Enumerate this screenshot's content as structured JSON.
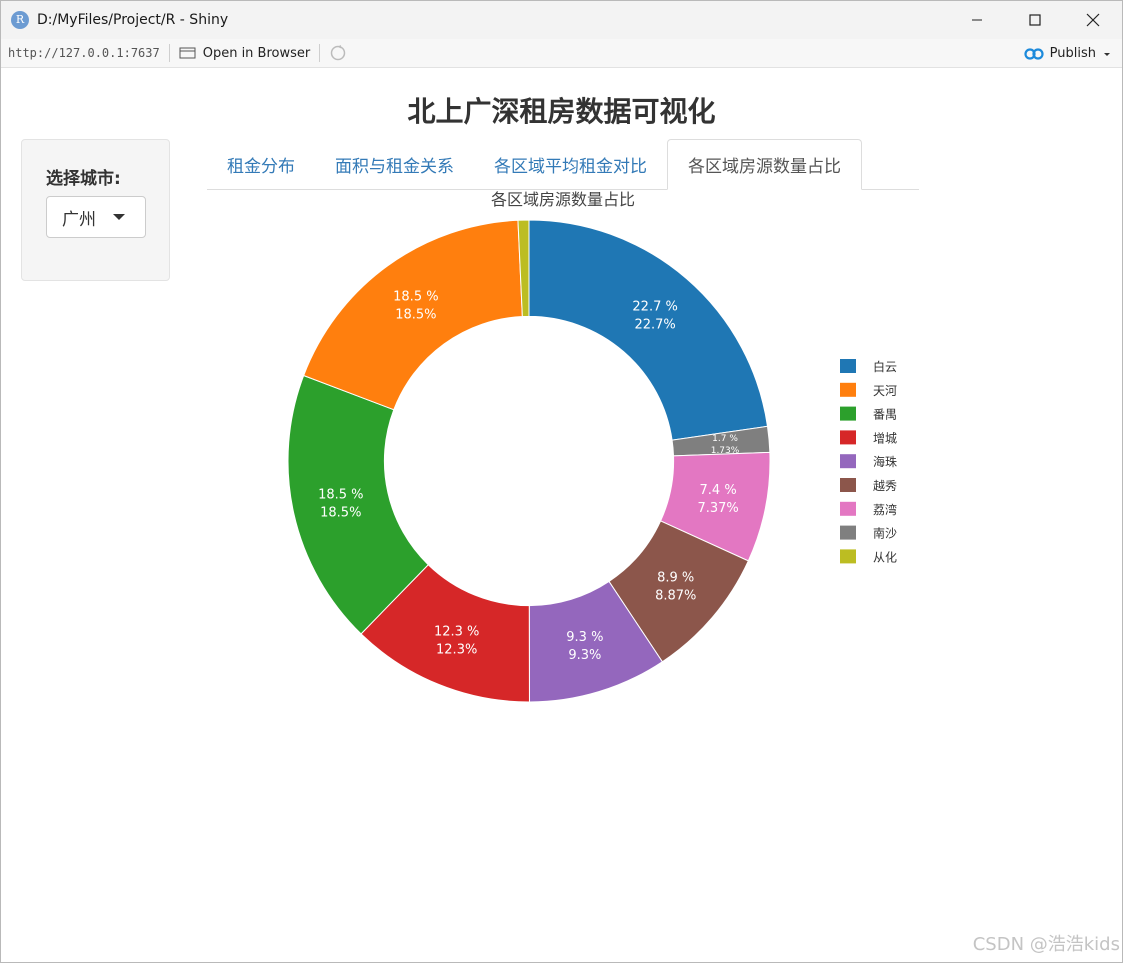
{
  "window": {
    "title": "D:/MyFiles/Project/R - Shiny",
    "app_icon": "R"
  },
  "toolbar": {
    "url": "http://127.0.0.1:7637",
    "open_in_browser": "Open in Browser",
    "publish": "Publish"
  },
  "page": {
    "title": "北上广深租房数据可视化"
  },
  "sidebar": {
    "label": "选择城市:",
    "selected_city": "广州"
  },
  "tabs": [
    {
      "label": "租金分布",
      "active": false
    },
    {
      "label": "面积与租金关系",
      "active": false
    },
    {
      "label": "各区域平均租金对比",
      "active": false
    },
    {
      "label": "各区域房源数量占比",
      "active": true
    }
  ],
  "chart_data": {
    "type": "pie",
    "title": "各区域房源数量占比",
    "hole": 0.6,
    "slices": [
      {
        "name": "白云",
        "value": 22.7,
        "label1": "22.7 %",
        "label2": "22.7%",
        "color": "#1f77b4"
      },
      {
        "name": "南沙",
        "value": 1.73,
        "label1": "1.7 %",
        "label2": "1.73%",
        "color": "#7f7f7f"
      },
      {
        "name": "荔湾",
        "value": 7.37,
        "label1": "7.4 %",
        "label2": "7.37%",
        "color": "#e377c2"
      },
      {
        "name": "越秀",
        "value": 8.87,
        "label1": "8.9 %",
        "label2": "8.87%",
        "color": "#8c564b"
      },
      {
        "name": "海珠",
        "value": 9.3,
        "label1": "9.3 %",
        "label2": "9.3%",
        "color": "#9467bd"
      },
      {
        "name": "增城",
        "value": 12.3,
        "label1": "12.3 %",
        "label2": "12.3%",
        "color": "#d62728"
      },
      {
        "name": "番禺",
        "value": 18.5,
        "label1": "18.5 %",
        "label2": "18.5%",
        "color": "#2ca02c"
      },
      {
        "name": "天河",
        "value": 18.5,
        "label1": "18.5 %",
        "label2": "18.5%",
        "color": "#ff7f0e"
      },
      {
        "name": "从化",
        "value": 0.73,
        "label1": "",
        "label2": "",
        "color": "#bcbd22"
      }
    ],
    "legend": [
      "白云",
      "天河",
      "番禺",
      "增城",
      "海珠",
      "越秀",
      "荔湾",
      "南沙",
      "从化"
    ],
    "legend_position": "right"
  },
  "watermark": "CSDN @浩浩kids"
}
